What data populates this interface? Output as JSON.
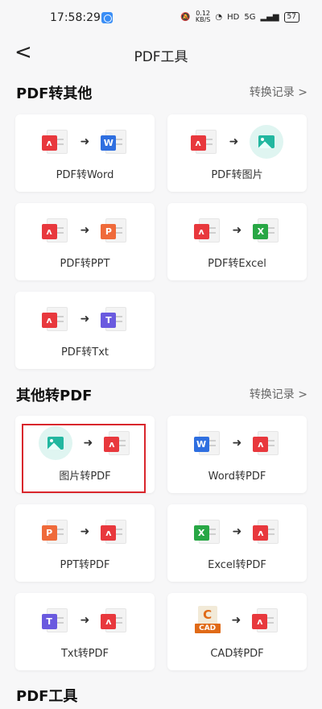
{
  "status": {
    "time": "17:58:29",
    "net_speed": "0.12",
    "net_unit": "KB/S",
    "hd": "HD",
    "signal_label": "5G",
    "battery": "57"
  },
  "header": {
    "back": "<",
    "title": "PDF工具"
  },
  "section1": {
    "title": "PDF转其他",
    "link": "转换记录 >"
  },
  "section2": {
    "title": "其他转PDF",
    "link": "转换记录 >"
  },
  "section3": {
    "title": "PDF工具"
  },
  "arrow": "➜",
  "badges": {
    "pdf": "ᴧ",
    "word": "W",
    "ppt": "P",
    "excel": "X",
    "txt": "T",
    "cad_letter": "C",
    "cad_bar": "CAD"
  },
  "pdf_to_other": [
    {
      "label": "PDF转Word"
    },
    {
      "label": "PDF转图片"
    },
    {
      "label": "PDF转PPT"
    },
    {
      "label": "PDF转Excel"
    },
    {
      "label": "PDF转Txt"
    }
  ],
  "other_to_pdf": [
    {
      "label": "图片转PDF"
    },
    {
      "label": "Word转PDF"
    },
    {
      "label": "PPT转PDF"
    },
    {
      "label": "Excel转PDF"
    },
    {
      "label": "Txt转PDF"
    },
    {
      "label": "CAD转PDF"
    }
  ],
  "colors": {
    "pdf": "#e8383d",
    "word": "#2f6fe0",
    "ppt": "#ef6a3a",
    "excel": "#28a745",
    "txt": "#6a5adf",
    "image": "#22b7a0",
    "cad": "#e06a17",
    "highlight": "#d9262c"
  }
}
